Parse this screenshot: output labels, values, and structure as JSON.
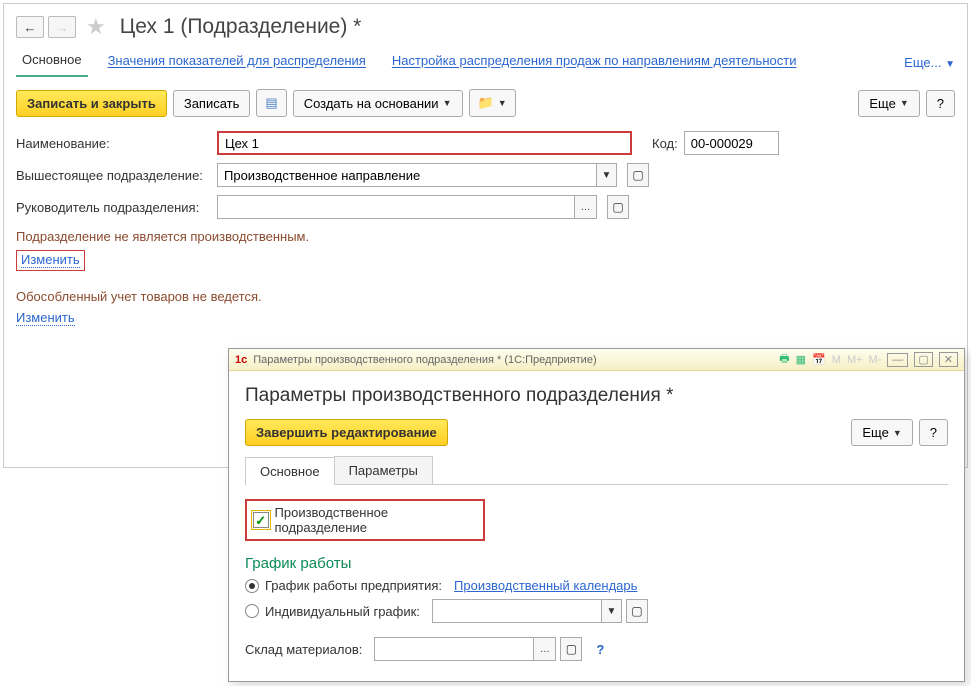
{
  "header": {
    "title": "Цех 1 (Подразделение) *"
  },
  "tabs": {
    "main": "Основное",
    "indicators": "Значения показателей для распределения",
    "sales": "Настройка распределения продаж по направлениям деятельности",
    "more": "Еще..."
  },
  "toolbar": {
    "save_close": "Записать и закрыть",
    "save": "Записать",
    "create_based": "Создать на основании",
    "more": "Еще",
    "help": "?"
  },
  "form": {
    "name_label": "Наименование:",
    "name_value": "Цех 1",
    "code_label": "Код:",
    "code_value": "00-000029",
    "parent_label": "Вышестоящее подразделение:",
    "parent_value": "Производственное направление",
    "head_label": "Руководитель подразделения:",
    "head_value": "",
    "not_production": "Подразделение не является производственным.",
    "change": "Изменить",
    "no_separate": "Обособленный учет товаров не ведется."
  },
  "popup": {
    "titlebar": "Параметры производственного подразделения * (1С:Предприятие)",
    "title": "Параметры производственного подразделения *",
    "finish": "Завершить редактирование",
    "more": "Еще",
    "help": "?",
    "tab_main": "Основное",
    "tab_params": "Параметры",
    "prod_check": "Производственное подразделение",
    "schedule_title": "График работы",
    "schedule_company": "График работы предприятия:",
    "schedule_link": "Производственный календарь",
    "schedule_individual": "Индивидуальный график:",
    "materials_label": "Склад материалов:",
    "materials_value": ""
  }
}
